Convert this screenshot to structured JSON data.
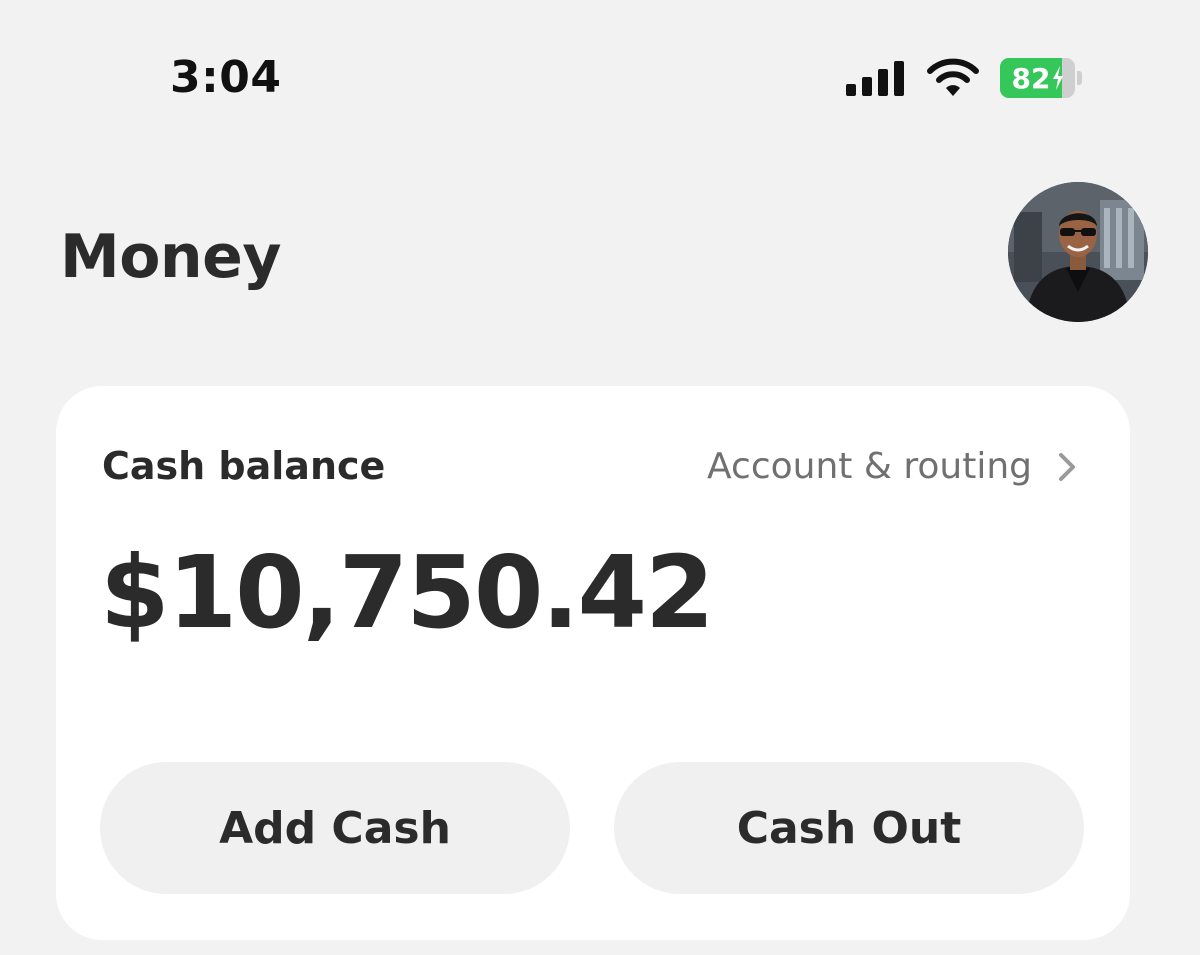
{
  "status_bar": {
    "time": "3:04",
    "battery_percent": "82",
    "battery_level": 0.82,
    "battery_color": "#35c759",
    "icons": [
      "signal-icon",
      "wifi-icon",
      "battery-charging-icon"
    ]
  },
  "header": {
    "title": "Money",
    "avatar_icon": "profile-avatar"
  },
  "balance_card": {
    "label": "Cash balance",
    "account_link": "Account & routing",
    "balance": "$10,750.42",
    "add_cash": "Add Cash",
    "cash_out": "Cash Out"
  }
}
